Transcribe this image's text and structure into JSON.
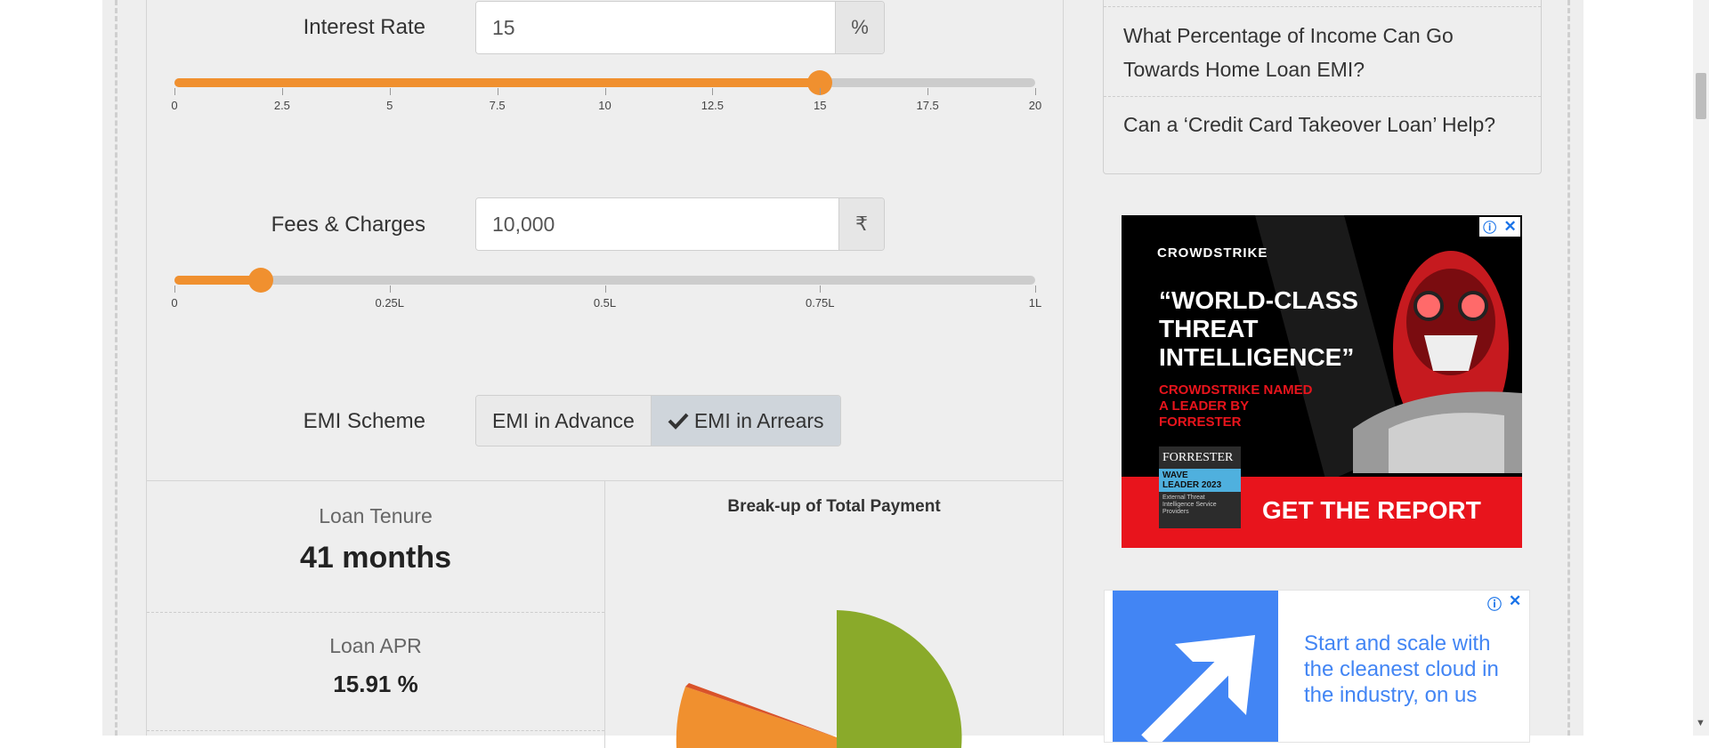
{
  "calculator": {
    "interest_rate": {
      "label": "Interest Rate",
      "value": "15",
      "unit": "%",
      "slider_value": 15,
      "slider_max": 20,
      "ticks": [
        "0",
        "2.5",
        "5",
        "7.5",
        "10",
        "12.5",
        "15",
        "17.5",
        "20"
      ]
    },
    "fees": {
      "label": "Fees & Charges",
      "value": "10,000",
      "unit": "₹",
      "slider_value": 10000,
      "slider_max": 100000,
      "ticks": [
        "0",
        "0.25L",
        "0.5L",
        "0.75L",
        "1L"
      ]
    },
    "emi_scheme": {
      "label": "EMI Scheme",
      "options": [
        "EMI in Advance",
        "EMI in Arrears"
      ],
      "selected": "EMI in Arrears"
    }
  },
  "results": {
    "loan_tenure": {
      "label": "Loan Tenure",
      "value": "41 months"
    },
    "loan_apr": {
      "label": "Loan APR",
      "value": "15.91 %"
    }
  },
  "chart_data": {
    "type": "pie",
    "title": "Break-up of Total Payment",
    "colors": [
      "#8aaa2a",
      "#f0902f",
      "#d9532a"
    ]
  },
  "sidebar": {
    "links": [
      "What Percentage of Income Can Go Towards Home Loan EMI?",
      "Can a ‘Credit Card Takeover Loan’ Help?"
    ]
  },
  "ads": {
    "crowdstrike": {
      "brand": "CROWDSTRIKE",
      "headline": "“WORLD-CLASS THREAT INTELLIGENCE”",
      "sub": "CROWDSTRIKE NAMED A LEADER BY FORRESTER",
      "badge_brand": "FORRESTER",
      "badge_line1": "WAVE",
      "badge_line2": "LEADER 2023",
      "badge_note": "External Threat Intelligence Service Providers",
      "cta": "GET THE REPORT",
      "bg_color": "#000000",
      "accent_color": "#e8141c"
    },
    "cloud": {
      "text": "Start and scale with the cleanest cloud in the industry, on us",
      "accent_color": "#4285f4"
    }
  }
}
